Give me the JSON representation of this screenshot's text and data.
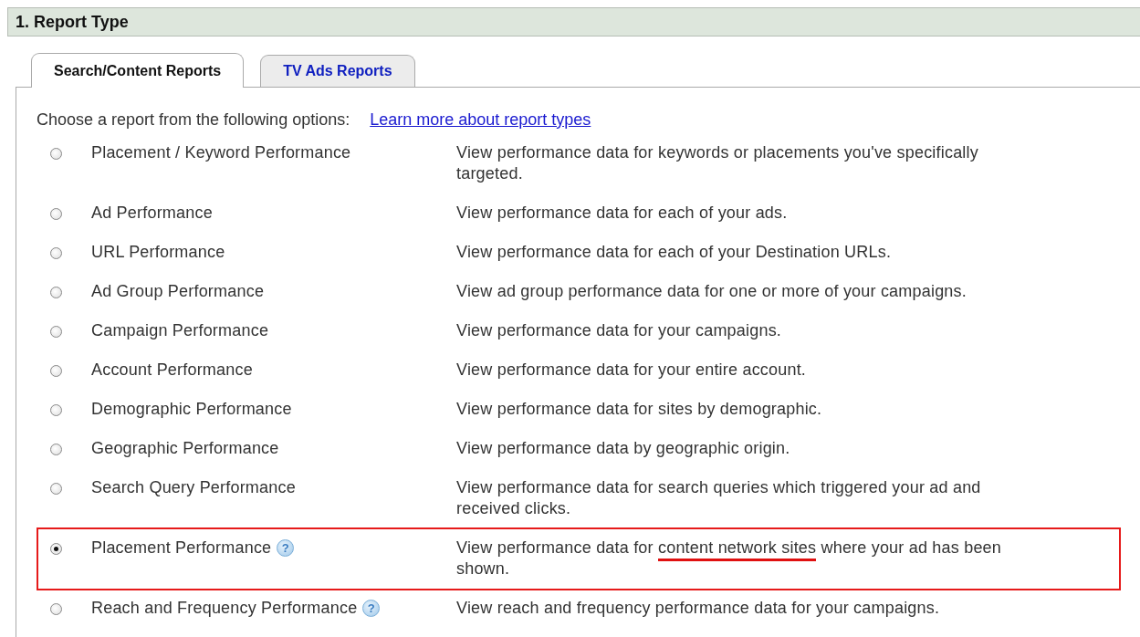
{
  "section": {
    "title": "1. Report Type"
  },
  "tabs": [
    {
      "label": "Search/Content Reports",
      "selected": true
    },
    {
      "label": "TV Ads Reports",
      "selected": false
    }
  ],
  "intro": {
    "text": "Choose a report from the following options:",
    "link": "Learn more about report types"
  },
  "options": [
    {
      "label": "Placement / Keyword Performance",
      "selected": false,
      "highlighted": false,
      "description": [
        {
          "text": "View performance data for keywords or placements you've specifically targeted.",
          "underlined": false
        }
      ]
    },
    {
      "label": "Ad Performance",
      "selected": false,
      "highlighted": false,
      "description": [
        {
          "text": "View performance data for each of your ads.",
          "underlined": false
        }
      ]
    },
    {
      "label": "URL Performance",
      "selected": false,
      "highlighted": false,
      "description": [
        {
          "text": "View performance data for each of your Destination URLs.",
          "underlined": false
        }
      ]
    },
    {
      "label": "Ad Group Performance",
      "selected": false,
      "highlighted": false,
      "description": [
        {
          "text": "View ad group performance data for one or more of your campaigns.",
          "underlined": false
        }
      ]
    },
    {
      "label": "Campaign Performance",
      "selected": false,
      "highlighted": false,
      "description": [
        {
          "text": "View performance data for your campaigns.",
          "underlined": false
        }
      ]
    },
    {
      "label": "Account Performance",
      "selected": false,
      "highlighted": false,
      "description": [
        {
          "text": "View performance data for your entire account.",
          "underlined": false
        }
      ]
    },
    {
      "label": "Demographic Performance",
      "selected": false,
      "highlighted": false,
      "description": [
        {
          "text": "View performance data for sites by demographic.",
          "underlined": false
        }
      ]
    },
    {
      "label": "Geographic Performance",
      "selected": false,
      "highlighted": false,
      "description": [
        {
          "text": "View performance data by geographic origin.",
          "underlined": false
        }
      ]
    },
    {
      "label": "Search Query Performance",
      "selected": false,
      "highlighted": false,
      "description": [
        {
          "text": "View performance data for search queries which triggered your ad and received clicks.",
          "underlined": false
        }
      ]
    },
    {
      "label": "Placement Performance",
      "help": "?",
      "selected": true,
      "highlighted": true,
      "description": [
        {
          "text": "View performance data for ",
          "underlined": false
        },
        {
          "text": "content network sites",
          "underlined": true
        },
        {
          "text": " where your ad has been shown.",
          "underlined": false
        }
      ]
    },
    {
      "label": "Reach and Frequency Performance",
      "help": "?",
      "selected": false,
      "highlighted": false,
      "description": [
        {
          "text": "View reach and frequency performance data for your campaigns.",
          "underlined": false
        }
      ]
    }
  ]
}
